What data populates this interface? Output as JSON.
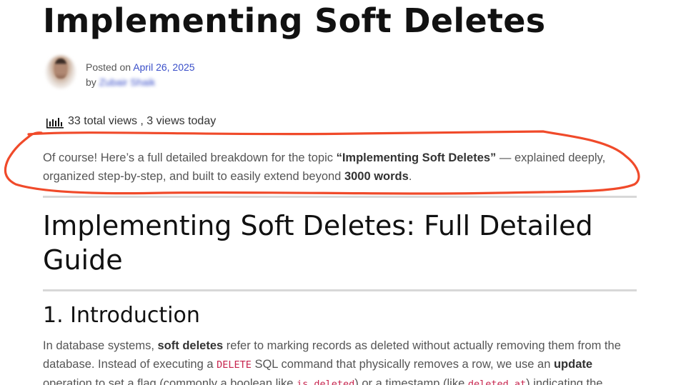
{
  "post": {
    "title": "Implementing Soft Deletes",
    "posted_on_label": "Posted on",
    "date": "April 26, 2025",
    "by_label": "by",
    "author": "Zubair Shaik"
  },
  "views": {
    "text": "33 total views , 3 views today",
    "icon": "bar-chart-icon"
  },
  "intro": {
    "part1": "Of course! Here’s a full detailed breakdown for the topic ",
    "topic": "“Implementing Soft Deletes”",
    "part2": " — explained deeply, organized step-by-step, and built to easily extend beyond ",
    "words": "3000 words",
    "part3": "."
  },
  "article": {
    "heading": "Implementing Soft Deletes: Full Detailed Guide",
    "section1_heading": "1. Introduction",
    "p1_a": "In database systems, ",
    "p1_b": "soft deletes",
    "p1_c": " refer to marking records as deleted without actually removing them from the database. Instead of executing a ",
    "p1_code1": "DELETE",
    "p1_d": " SQL command that physically removes a row, we use an ",
    "p1_e": "update",
    "p1_f": " operation to set a flag (commonly a boolean like ",
    "p1_code2": "is_deleted",
    "p1_g": ") or a timestamp (like ",
    "p1_code3": "deleted_at",
    "p1_h": ") indicating the"
  },
  "colors": {
    "link": "#3a4fc9",
    "annotation": "#f04a2a",
    "code": "#c7254e"
  }
}
